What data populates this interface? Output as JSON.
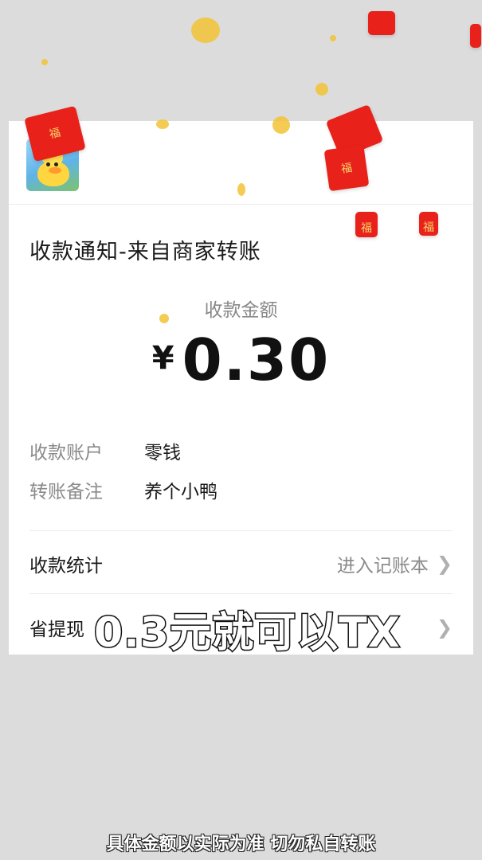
{
  "notification": {
    "title": "收款通知-来自商家转账",
    "amount_label": "收款金额",
    "currency": "¥",
    "amount": "0.30",
    "account_label": "收款账户",
    "account_value": "零钱",
    "remark_label": "转账备注",
    "remark_value": "养个小鸭",
    "stats_label": "收款统计",
    "stats_action": "进入记账本",
    "save_label": "省提现"
  },
  "captions": {
    "overlay": "0.3元就可以TX",
    "bottom": "具体金额以实际为准 切勿私自转账"
  },
  "decoration": {
    "envelope_glyph": "福"
  },
  "colors": {
    "background": "#dcdcdc",
    "envelope": "#e8211a",
    "coin": "#f2c335"
  }
}
